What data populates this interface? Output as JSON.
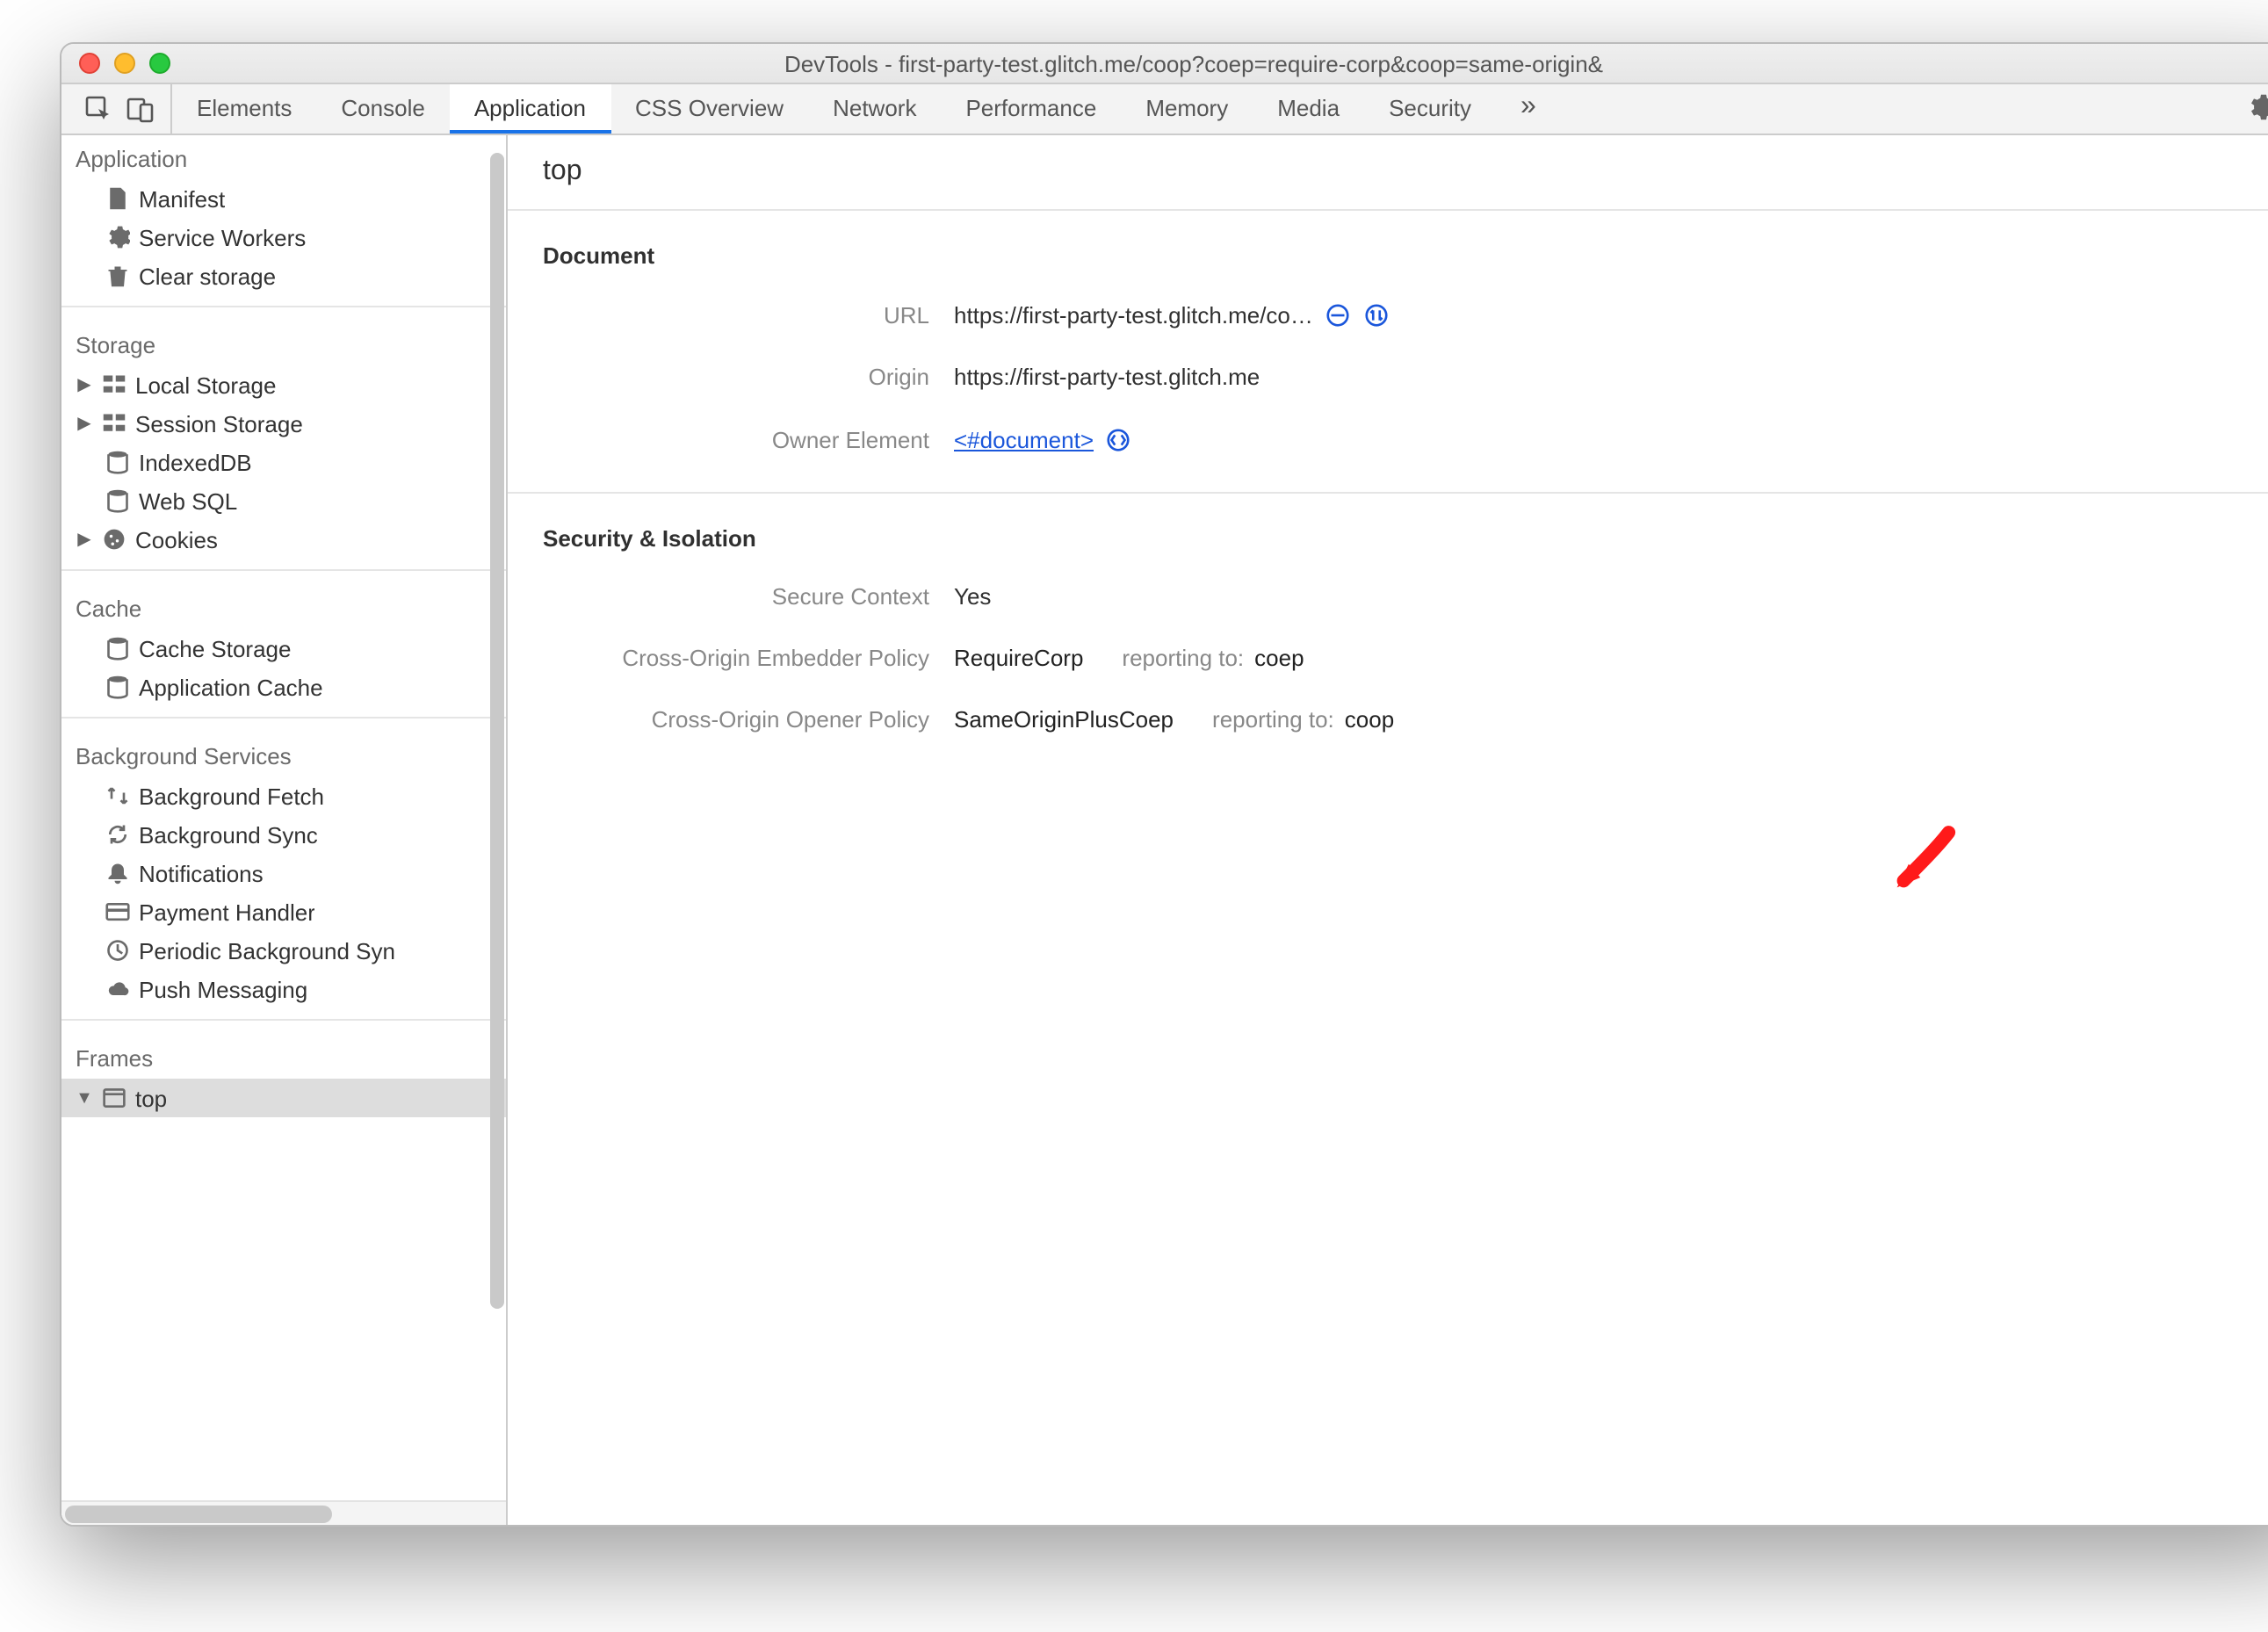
{
  "window": {
    "title": "DevTools - first-party-test.glitch.me/coop?coep=require-corp&coop=same-origin&"
  },
  "tabs": {
    "items": [
      "Elements",
      "Console",
      "Application",
      "CSS Overview",
      "Network",
      "Performance",
      "Memory",
      "Media",
      "Security"
    ],
    "active": "Application"
  },
  "sidebar": {
    "sections": [
      {
        "title": "Application",
        "items": [
          {
            "icon": "file",
            "label": "Manifest"
          },
          {
            "icon": "gear",
            "label": "Service Workers"
          },
          {
            "icon": "trash",
            "label": "Clear storage"
          }
        ]
      },
      {
        "title": "Storage",
        "items": [
          {
            "icon": "grid",
            "label": "Local Storage",
            "disclosure": "▶"
          },
          {
            "icon": "grid",
            "label": "Session Storage",
            "disclosure": "▶"
          },
          {
            "icon": "db",
            "label": "IndexedDB"
          },
          {
            "icon": "db",
            "label": "Web SQL"
          },
          {
            "icon": "cookie",
            "label": "Cookies",
            "disclosure": "▶"
          }
        ]
      },
      {
        "title": "Cache",
        "items": [
          {
            "icon": "db",
            "label": "Cache Storage"
          },
          {
            "icon": "db",
            "label": "Application Cache"
          }
        ]
      },
      {
        "title": "Background Services",
        "items": [
          {
            "icon": "transfer",
            "label": "Background Fetch"
          },
          {
            "icon": "sync",
            "label": "Background Sync"
          },
          {
            "icon": "bell",
            "label": "Notifications"
          },
          {
            "icon": "card",
            "label": "Payment Handler"
          },
          {
            "icon": "clock",
            "label": "Periodic Background Syn"
          },
          {
            "icon": "cloud",
            "label": "Push Messaging"
          }
        ]
      },
      {
        "title": "Frames",
        "items": [
          {
            "icon": "frame",
            "label": "top",
            "disclosure": "▼",
            "selected": true
          }
        ]
      }
    ]
  },
  "main": {
    "header": "top",
    "document": {
      "title": "Document",
      "url_label": "URL",
      "url_value": "https://first-party-test.glitch.me/co…",
      "origin_label": "Origin",
      "origin_value": "https://first-party-test.glitch.me",
      "owner_label": "Owner Element",
      "owner_value": "<#document>"
    },
    "security": {
      "title": "Security & Isolation",
      "secure_label": "Secure Context",
      "secure_value": "Yes",
      "coep_label": "Cross-Origin Embedder Policy",
      "coep_value": "RequireCorp",
      "coep_reporting_prefix": "reporting to:",
      "coep_reporting_target": "coep",
      "coop_label": "Cross-Origin Opener Policy",
      "coop_value": "SameOriginPlusCoep",
      "coop_reporting_prefix": "reporting to:",
      "coop_reporting_target": "coop"
    }
  }
}
